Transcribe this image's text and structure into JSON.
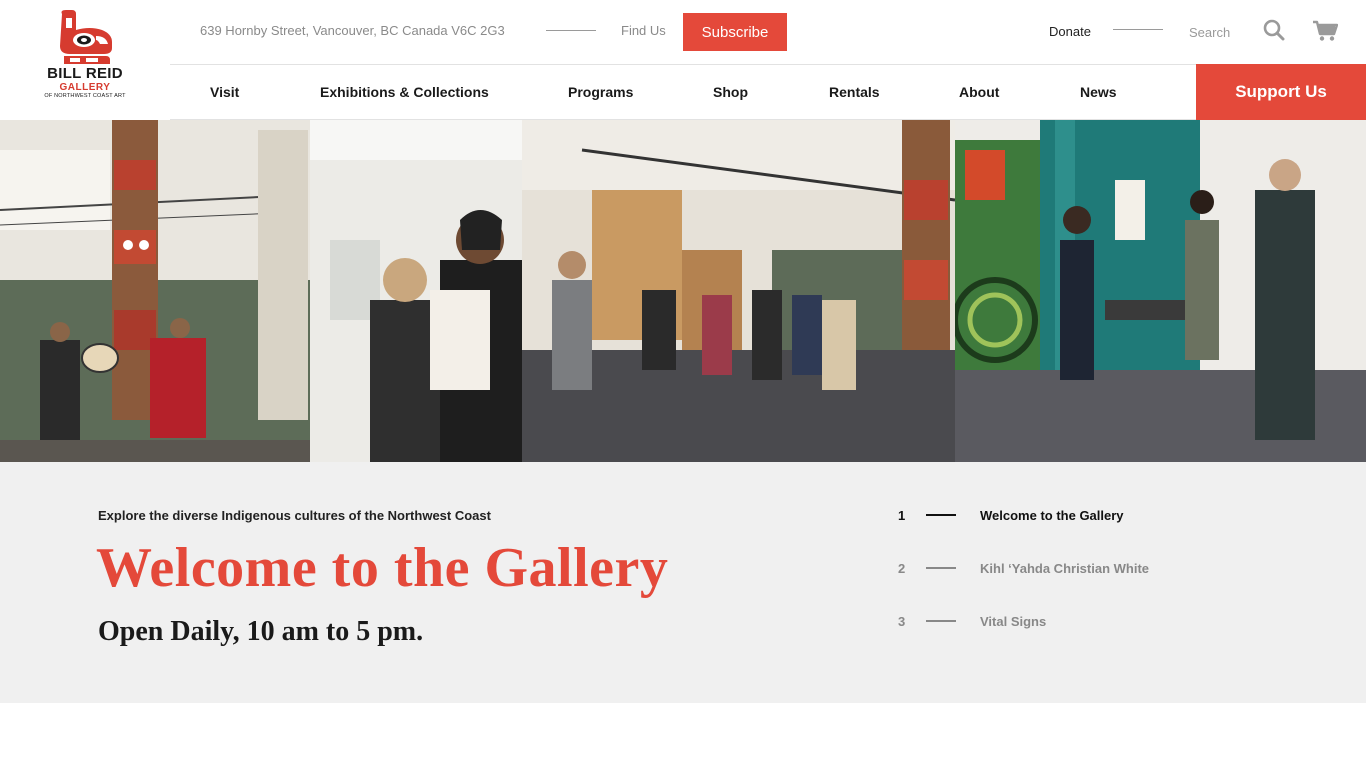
{
  "logo": {
    "line1": "BILL REID",
    "line2": "GALLERY",
    "line3": "OF NORTHWEST COAST ART"
  },
  "topbar": {
    "address": "639 Hornby Street, Vancouver, BC Canada V6C 2G3",
    "find_us": "Find Us",
    "subscribe": "Subscribe",
    "donate": "Donate",
    "search_label": "Search"
  },
  "nav": {
    "items": [
      "Visit",
      "Exhibitions & Collections",
      "Programs",
      "Shop",
      "Rentals",
      "About",
      "News"
    ],
    "support": "Support Us"
  },
  "hero": {
    "eyebrow": "Explore the diverse Indigenous cultures of the Northwest Coast",
    "title": "Welcome to the Gallery",
    "subtitle": "Open Daily, 10 am to 5 pm."
  },
  "slides": [
    {
      "num": "1",
      "label": "Welcome to the Gallery",
      "active": true
    },
    {
      "num": "2",
      "label": "Kihl ‘Yahda Christian White",
      "active": false
    },
    {
      "num": "3",
      "label": "Vital Signs",
      "active": false
    }
  ],
  "colors": {
    "accent": "#e4493a",
    "band": "#f0f0f0"
  },
  "icons": [
    "search-icon",
    "cart-icon"
  ]
}
